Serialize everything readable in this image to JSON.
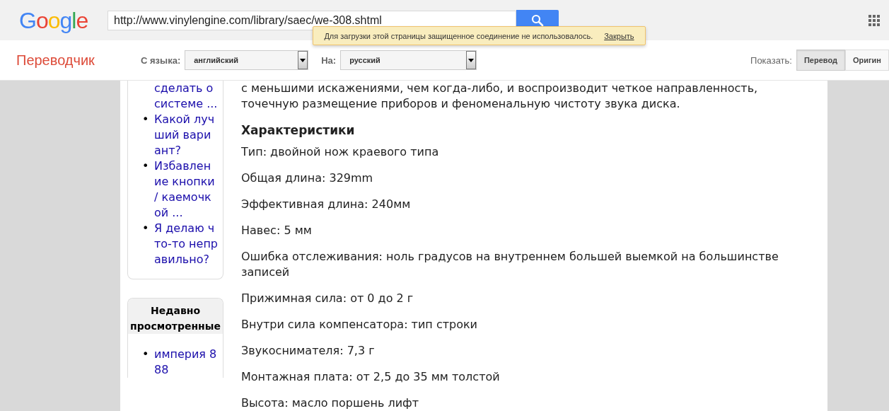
{
  "header": {
    "logo": "Google",
    "url": "http://www.vinylengine.com/library/saec/we-308.shtml"
  },
  "notice": {
    "text": "Для загрузки этой страницы защищенное соединение не использовалось.",
    "link": "Закрыть"
  },
  "toolbar": {
    "title": "Переводчик",
    "from_label": "С языка:",
    "from_value": "английский",
    "to_label": "На:",
    "to_value": "русский",
    "show_label": "Показать:",
    "views": [
      {
        "label": "Перевод",
        "selected": true
      },
      {
        "label": "Оригин",
        "selected": false
      }
    ]
  },
  "sidebar": {
    "links": [
      {
        "text": "сделать о системе ..."
      },
      {
        "bullet": "•",
        "text": "Какой лучший вариант?"
      },
      {
        "bullet": "•",
        "text": "Избавление кнопки / каемочкой ..."
      },
      {
        "bullet": "•",
        "text": "Я делаю что-то неправильно?"
      }
    ],
    "recent_title": "Недавно просмотренные",
    "recent": [
      {
        "bullet": "•",
        "text": "империя 888"
      }
    ]
  },
  "article": {
    "intro": [
      "с меньшими искажениями, чем когда-либо, и воспроизводит четкое направленность,",
      "точечную размещение приборов и феноменальную чистоту звука диска."
    ],
    "heading": "Характеристики",
    "specs": [
      "Тип: двойной нож краевого типа",
      "Общая длина: 329mm",
      "Эффективная длина: 240мм",
      "Навес: 5 мм",
      "Ошибка отслеживания: ноль градусов на внутреннем большей выемкой на большинстве записей",
      "Прижимная сила: от 0 до 2 г",
      "Внутри сила компенсатора: тип строки",
      "Звукоснимателя: 7,3 г",
      "Монтажная плата: от 2,5 до 35 мм толстой",
      "Высота: масло поршень лифт"
    ]
  }
}
